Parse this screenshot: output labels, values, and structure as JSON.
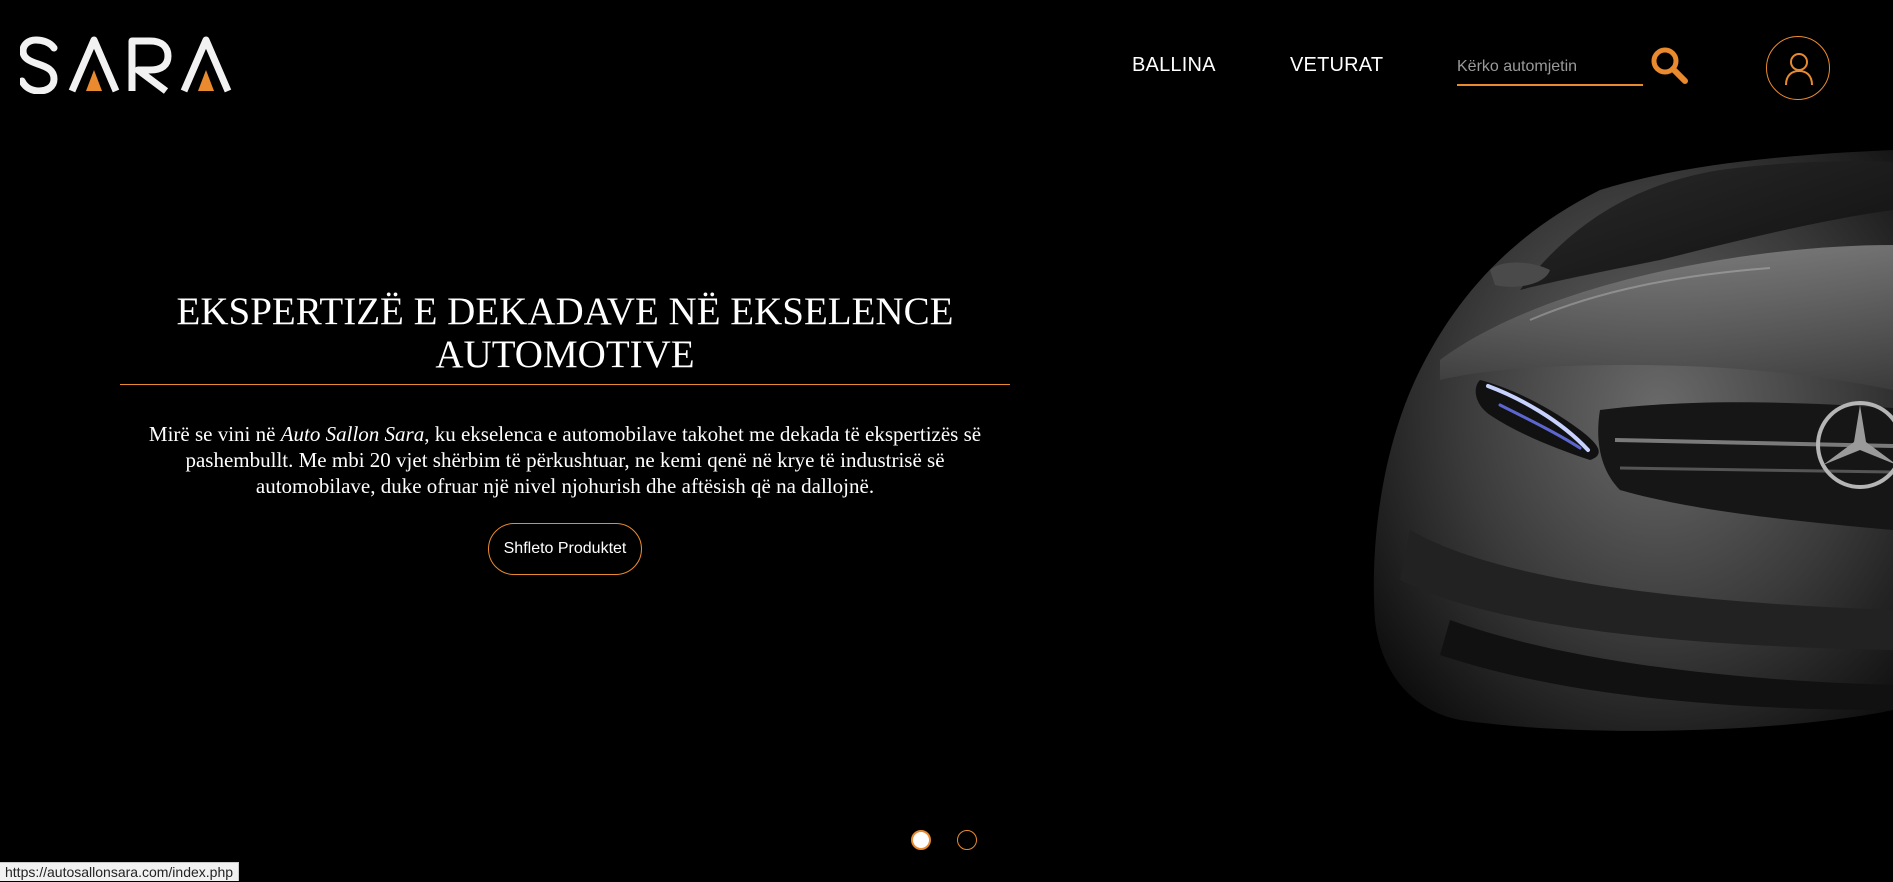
{
  "brand": {
    "logo_text": "SARA",
    "accent_color": "#e98a2f"
  },
  "nav": {
    "items": [
      {
        "label": "BALLINA"
      },
      {
        "label": "VETURAT"
      }
    ]
  },
  "search": {
    "placeholder": "Kërko automjetin",
    "icon": "search-icon"
  },
  "account": {
    "icon": "user-icon"
  },
  "hero": {
    "title": "EKSPERTIZË E DEKADAVE NË EKSELENCE AUTOMOTIVE",
    "intro_before": "Mirë se vini në ",
    "intro_emphasis": "Auto Sallon Sara",
    "intro_after": ", ku ekselenca e automobilave takohet me dekada të ekspertizës së pashembullt. Me mbi 20 vjet shërbim të përkushtuar, ne kemi qenë në krye të industrisë së automobilave, duke ofruar një nivel njohurish dhe aftësish që na dallojnë.",
    "cta_label": "Shfleto Produktet",
    "image": "car-front-image"
  },
  "carousel": {
    "slides": 2,
    "active_slide": 1
  },
  "status_bar": {
    "url": "https://autosallonsara.com/index.php"
  }
}
